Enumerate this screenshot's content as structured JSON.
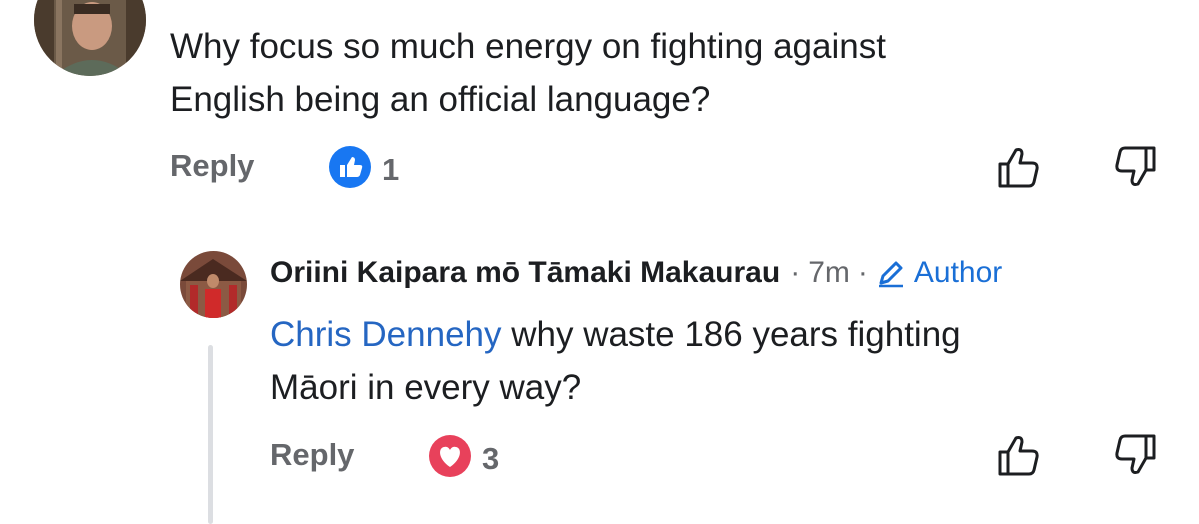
{
  "top_comment": {
    "text_line1": "Why focus so much energy on fighting against",
    "text_line2": "English being an official language?",
    "reply_label": "Reply",
    "reaction_count": "1",
    "reaction_type": "like",
    "like_color": "#1877f2"
  },
  "reply_comment": {
    "author": "Oriini Kaipara mō Tāmaki Makaurau",
    "separator": "·",
    "time": "7m",
    "badge_label": "Author",
    "mention": "Chris Dennehy",
    "text_line1_rest": " why waste 186 years fighting",
    "text_line2": "Māori in every way?",
    "reply_label": "Reply",
    "reaction_count": "3",
    "reaction_type": "love",
    "love_color": "#e8415b",
    "accent_color": "#2566c2"
  }
}
